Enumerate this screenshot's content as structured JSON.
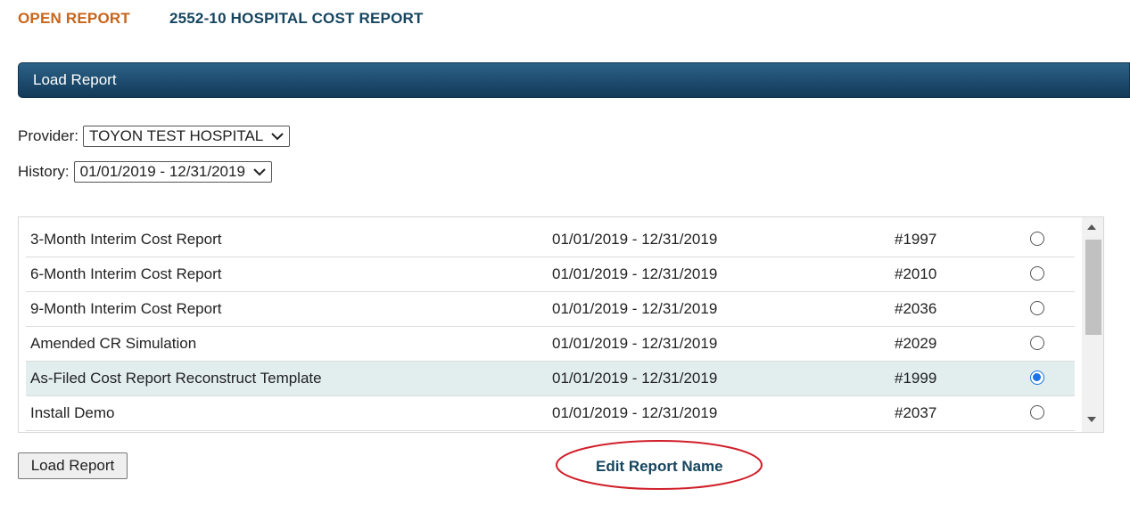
{
  "header": {
    "open_report_label": "OPEN REPORT",
    "report_type": "2552-10 HOSPITAL COST REPORT"
  },
  "panel": {
    "title": "Load Report"
  },
  "provider": {
    "label": "Provider:",
    "selected": "TOYON TEST HOSPITAL"
  },
  "history": {
    "label": "History:",
    "selected": "01/01/2019 - 12/31/2019"
  },
  "reports": [
    {
      "name": "3-Month Interim Cost Report",
      "dates": "01/01/2019 - 12/31/2019",
      "id": "#1997",
      "selected": false
    },
    {
      "name": "6-Month Interim Cost Report",
      "dates": "01/01/2019 - 12/31/2019",
      "id": "#2010",
      "selected": false
    },
    {
      "name": "9-Month Interim Cost Report",
      "dates": "01/01/2019 - 12/31/2019",
      "id": "#2036",
      "selected": false
    },
    {
      "name": "Amended CR Simulation",
      "dates": "01/01/2019 - 12/31/2019",
      "id": "#2029",
      "selected": false
    },
    {
      "name": "As-Filed Cost Report Reconstruct Template",
      "dates": "01/01/2019 - 12/31/2019",
      "id": "#1999",
      "selected": true
    },
    {
      "name": "Install Demo",
      "dates": "01/01/2019 - 12/31/2019",
      "id": "#2037",
      "selected": false
    }
  ],
  "actions": {
    "load_label": "Load Report",
    "edit_name_label": "Edit Report Name"
  },
  "colors": {
    "accent_orange": "#c8651b",
    "heading_navy": "#16455f",
    "panel_blue": "#1d4b6d",
    "selected_row": "#e2eeee",
    "radio_blue": "#1a73e8",
    "annotation_red": "#d0202a"
  }
}
